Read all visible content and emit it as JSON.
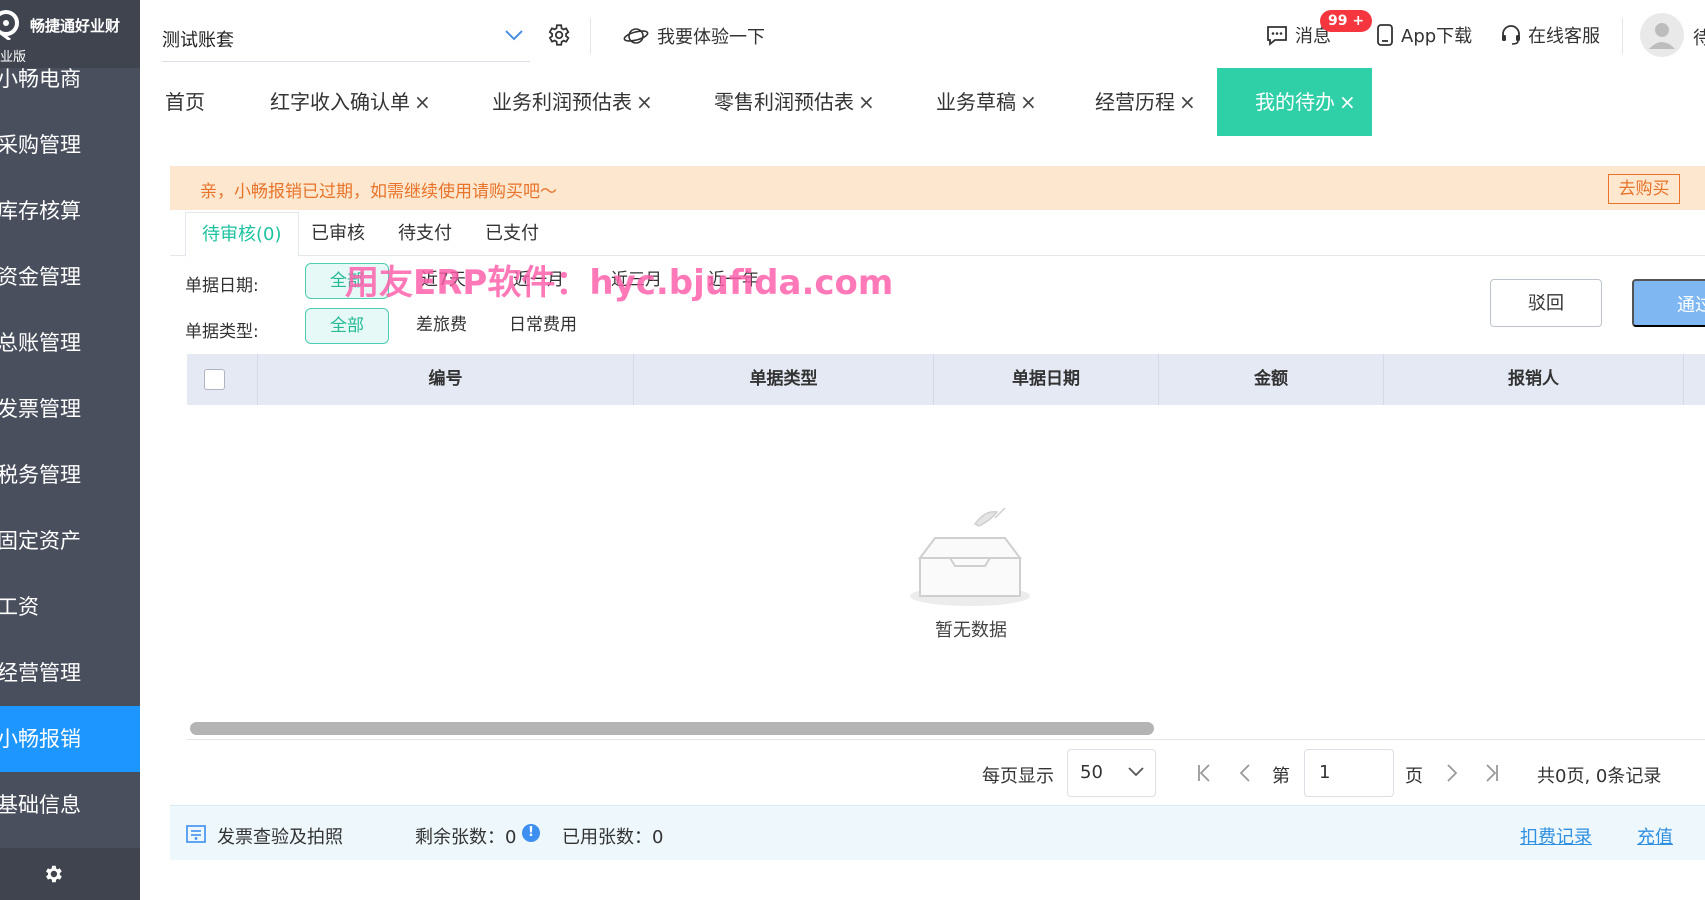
{
  "sidebar": {
    "logo_name": "畅捷通好业财",
    "edition": "业版",
    "items": [
      {
        "label": "小畅电商"
      },
      {
        "label": "采购管理"
      },
      {
        "label": "库存核算"
      },
      {
        "label": "资金管理"
      },
      {
        "label": "总账管理"
      },
      {
        "label": "发票管理"
      },
      {
        "label": "税务管理"
      },
      {
        "label": "固定资产"
      },
      {
        "label": "工资"
      },
      {
        "label": "经营管理"
      },
      {
        "label": "小畅报销",
        "active": true
      },
      {
        "label": "基础信息"
      }
    ]
  },
  "header": {
    "account": "测试账套",
    "try_label": "我要体验一下",
    "msg_label": "消息",
    "msg_badge": "99 +",
    "app_label": "App下载",
    "service_label": "在线客服",
    "user_name": "待"
  },
  "tabs": [
    {
      "label": "首页",
      "closable": false
    },
    {
      "label": "红字收入确认单",
      "closable": true
    },
    {
      "label": "业务利润预估表",
      "closable": true
    },
    {
      "label": "零售利润预估表",
      "closable": true
    },
    {
      "label": "业务草稿",
      "closable": true
    },
    {
      "label": "经营历程",
      "closable": true
    },
    {
      "label": "我的待办",
      "closable": true,
      "active": true
    }
  ],
  "close_glyph": "×",
  "notice": {
    "text": "亲，小畅报销已过期，如需继续使用请购买吧～",
    "button": "去购买"
  },
  "subtabs": [
    {
      "label": "待审核(0)",
      "active": true
    },
    {
      "label": "已审核"
    },
    {
      "label": "待支付"
    },
    {
      "label": "已支付"
    }
  ],
  "filters": {
    "date_label": "单据日期:",
    "date_options": [
      "全部",
      "近7天",
      "近一月",
      "近三月",
      "近一年"
    ],
    "type_label": "单据类型:",
    "type_options": [
      "全部",
      "差旅费",
      "日常费用"
    ]
  },
  "watermark": "用友ERP软件：hyc.bjufida.com",
  "actions": {
    "reject": "驳回",
    "pass": "通过"
  },
  "table": {
    "columns": [
      "编号",
      "单据类型",
      "单据日期",
      "金额",
      "报销人"
    ],
    "empty_text": "暂无数据"
  },
  "pagination": {
    "per_page_label": "每页显示",
    "per_page": "50",
    "page_prefix": "第",
    "page": "1",
    "page_suffix": "页",
    "summary": "共0页, 0条记录"
  },
  "bottom_bar": {
    "invoice_label": "发票查验及拍照",
    "remaining": "剩余张数：0",
    "used": "已用张数：0",
    "fee_record": "扣费记录",
    "recharge": "充值"
  },
  "colors": {
    "sidebar_bg": "#4a4f5e",
    "sidebar_active": "#1e96ff",
    "tab_active": "#2fcfa8",
    "notice_bg": "#fde8cf",
    "notice_text": "#e8732a",
    "badge": "#f5363f",
    "pass_button": "#7fb7f2"
  }
}
